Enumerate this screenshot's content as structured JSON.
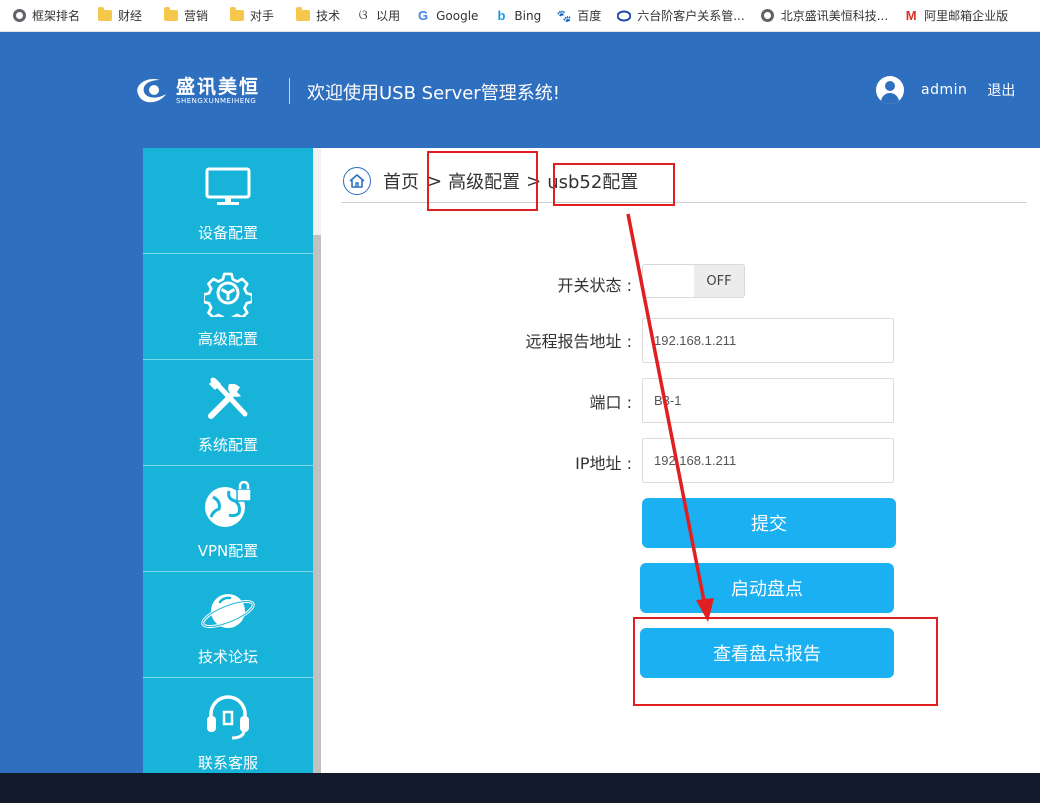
{
  "bookmarks": [
    {
      "label": "框架排名",
      "icon": "globe-icon"
    },
    {
      "label": "财经",
      "icon": "folder-icon"
    },
    {
      "label": "营销",
      "icon": "folder-icon"
    },
    {
      "label": "对手",
      "icon": "folder-icon"
    },
    {
      "label": "技术",
      "icon": "folder-icon"
    },
    {
      "label": "以用",
      "icon": "tool-icon"
    },
    {
      "label": "Google",
      "icon": "google-icon"
    },
    {
      "label": "Bing",
      "icon": "bing-icon"
    },
    {
      "label": "百度",
      "icon": "baidu-icon"
    },
    {
      "label": "六台阶客户关系管...",
      "icon": "site-icon"
    },
    {
      "label": "北京盛讯美恒科技...",
      "icon": "globe-icon"
    },
    {
      "label": "阿里邮箱企业版",
      "icon": "mail-icon"
    }
  ],
  "header": {
    "logo_cn": "盛讯美恒",
    "logo_en": "SHENGXUNMEIHENG",
    "welcome": "欢迎使用USB Server管理系统!",
    "username": "admin",
    "logout": "退出"
  },
  "sidebar": {
    "items": [
      {
        "label": "设备配置",
        "icon": "monitor-icon"
      },
      {
        "label": "高级配置",
        "icon": "gear-icon"
      },
      {
        "label": "系统配置",
        "icon": "tools-icon"
      },
      {
        "label": "VPN配置",
        "icon": "globe-lock-icon"
      },
      {
        "label": "技术论坛",
        "icon": "planet-icon"
      },
      {
        "label": "联系客服",
        "icon": "headset-icon"
      }
    ]
  },
  "breadcrumb": {
    "home": "首页",
    "sep": ">",
    "level1": "高级配置",
    "level2": "usb52配置"
  },
  "form": {
    "switch_label": "开关状态 :",
    "switch_state": "OFF",
    "report_label": "远程报告地址 :",
    "report_value": "192.168.1.211",
    "port_label": "端口 :",
    "port_value": "B3-1",
    "ip_label": "IP地址 :",
    "ip_value": "192.168.1.211"
  },
  "buttons": {
    "submit": "提交",
    "start_inventory": "启动盘点",
    "view_report": "查看盘点报告"
  },
  "colors": {
    "header_bg": "#2f6fbf",
    "sidebar_bg": "#17b3d8",
    "button_bg": "#1ab0f2",
    "annotation": "#e02020"
  }
}
